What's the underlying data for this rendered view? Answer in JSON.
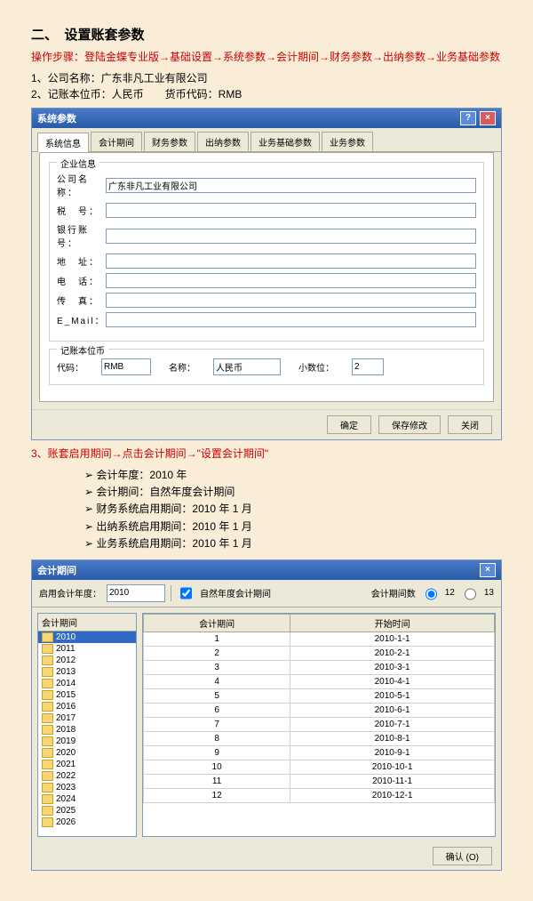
{
  "title": "二、　设置账套参数",
  "steps_red": "操作步骤：登陆金蝶专业版→基础设置→系统参数→会计期间→财务参数→出纳参数→业务基础参数",
  "line1": "1、公司名称：广东非凡工业有限公司",
  "line2": "2、记账本位币：人民币　　货币代码：RMB",
  "win1": {
    "title": "系统参数",
    "tabs": [
      "系统信息",
      "会计期间",
      "财务参数",
      "出纳参数",
      "业务基础参数",
      "业务参数"
    ],
    "group1": "企业信息",
    "labels": {
      "name": "公司名称：",
      "tax": "税　号：",
      "bank": "银行账号：",
      "addr": "地　址：",
      "tel": "电　话：",
      "fax": "传　真：",
      "mail": "E_Mail："
    },
    "company": "广东非凡工业有限公司",
    "group2": "记账本位币",
    "curr": {
      "code_l": "代码：",
      "code": "RMB",
      "name_l": "名称：",
      "name": "人民币",
      "dec_l": "小数位：",
      "dec": "2"
    },
    "btns": [
      "确定",
      "保存修改",
      "关闭"
    ]
  },
  "line3": "3、账套启用期间→点击会计期间→\"设置会计期间\"",
  "bullets": [
    "会计年度：2010 年",
    "会计期间：自然年度会计期间",
    "财务系统启用期间：2010 年 1 月",
    "出纳系统启用期间：2010 年 1 月",
    "业务系统启用期间：2010 年 1 月"
  ],
  "win2": {
    "title": "会计期间",
    "toolbar": {
      "y_l": "启用会计年度：",
      "year": "2010",
      "nat": "自然年度会计期间",
      "p_l": "会计期间数",
      "r12": "12",
      "r13": "13"
    },
    "tree_hdr": "会计期间",
    "years": [
      "2010",
      "2011",
      "2012",
      "2013",
      "2014",
      "2015",
      "2016",
      "2017",
      "2018",
      "2019",
      "2020",
      "2021",
      "2022",
      "2023",
      "2024",
      "2025",
      "2026"
    ],
    "cols": [
      "会计期间",
      "开始时间"
    ],
    "rows": [
      [
        "1",
        "2010-1-1"
      ],
      [
        "2",
        "2010-2-1"
      ],
      [
        "3",
        "2010-3-1"
      ],
      [
        "4",
        "2010-4-1"
      ],
      [
        "5",
        "2010-5-1"
      ],
      [
        "6",
        "2010-6-1"
      ],
      [
        "7",
        "2010-7-1"
      ],
      [
        "8",
        "2010-8-1"
      ],
      [
        "9",
        "2010-9-1"
      ],
      [
        "10",
        "2010-10-1"
      ],
      [
        "11",
        "2010-11-1"
      ],
      [
        "12",
        "2010-12-1"
      ]
    ],
    "ok": "确认 (O)"
  }
}
